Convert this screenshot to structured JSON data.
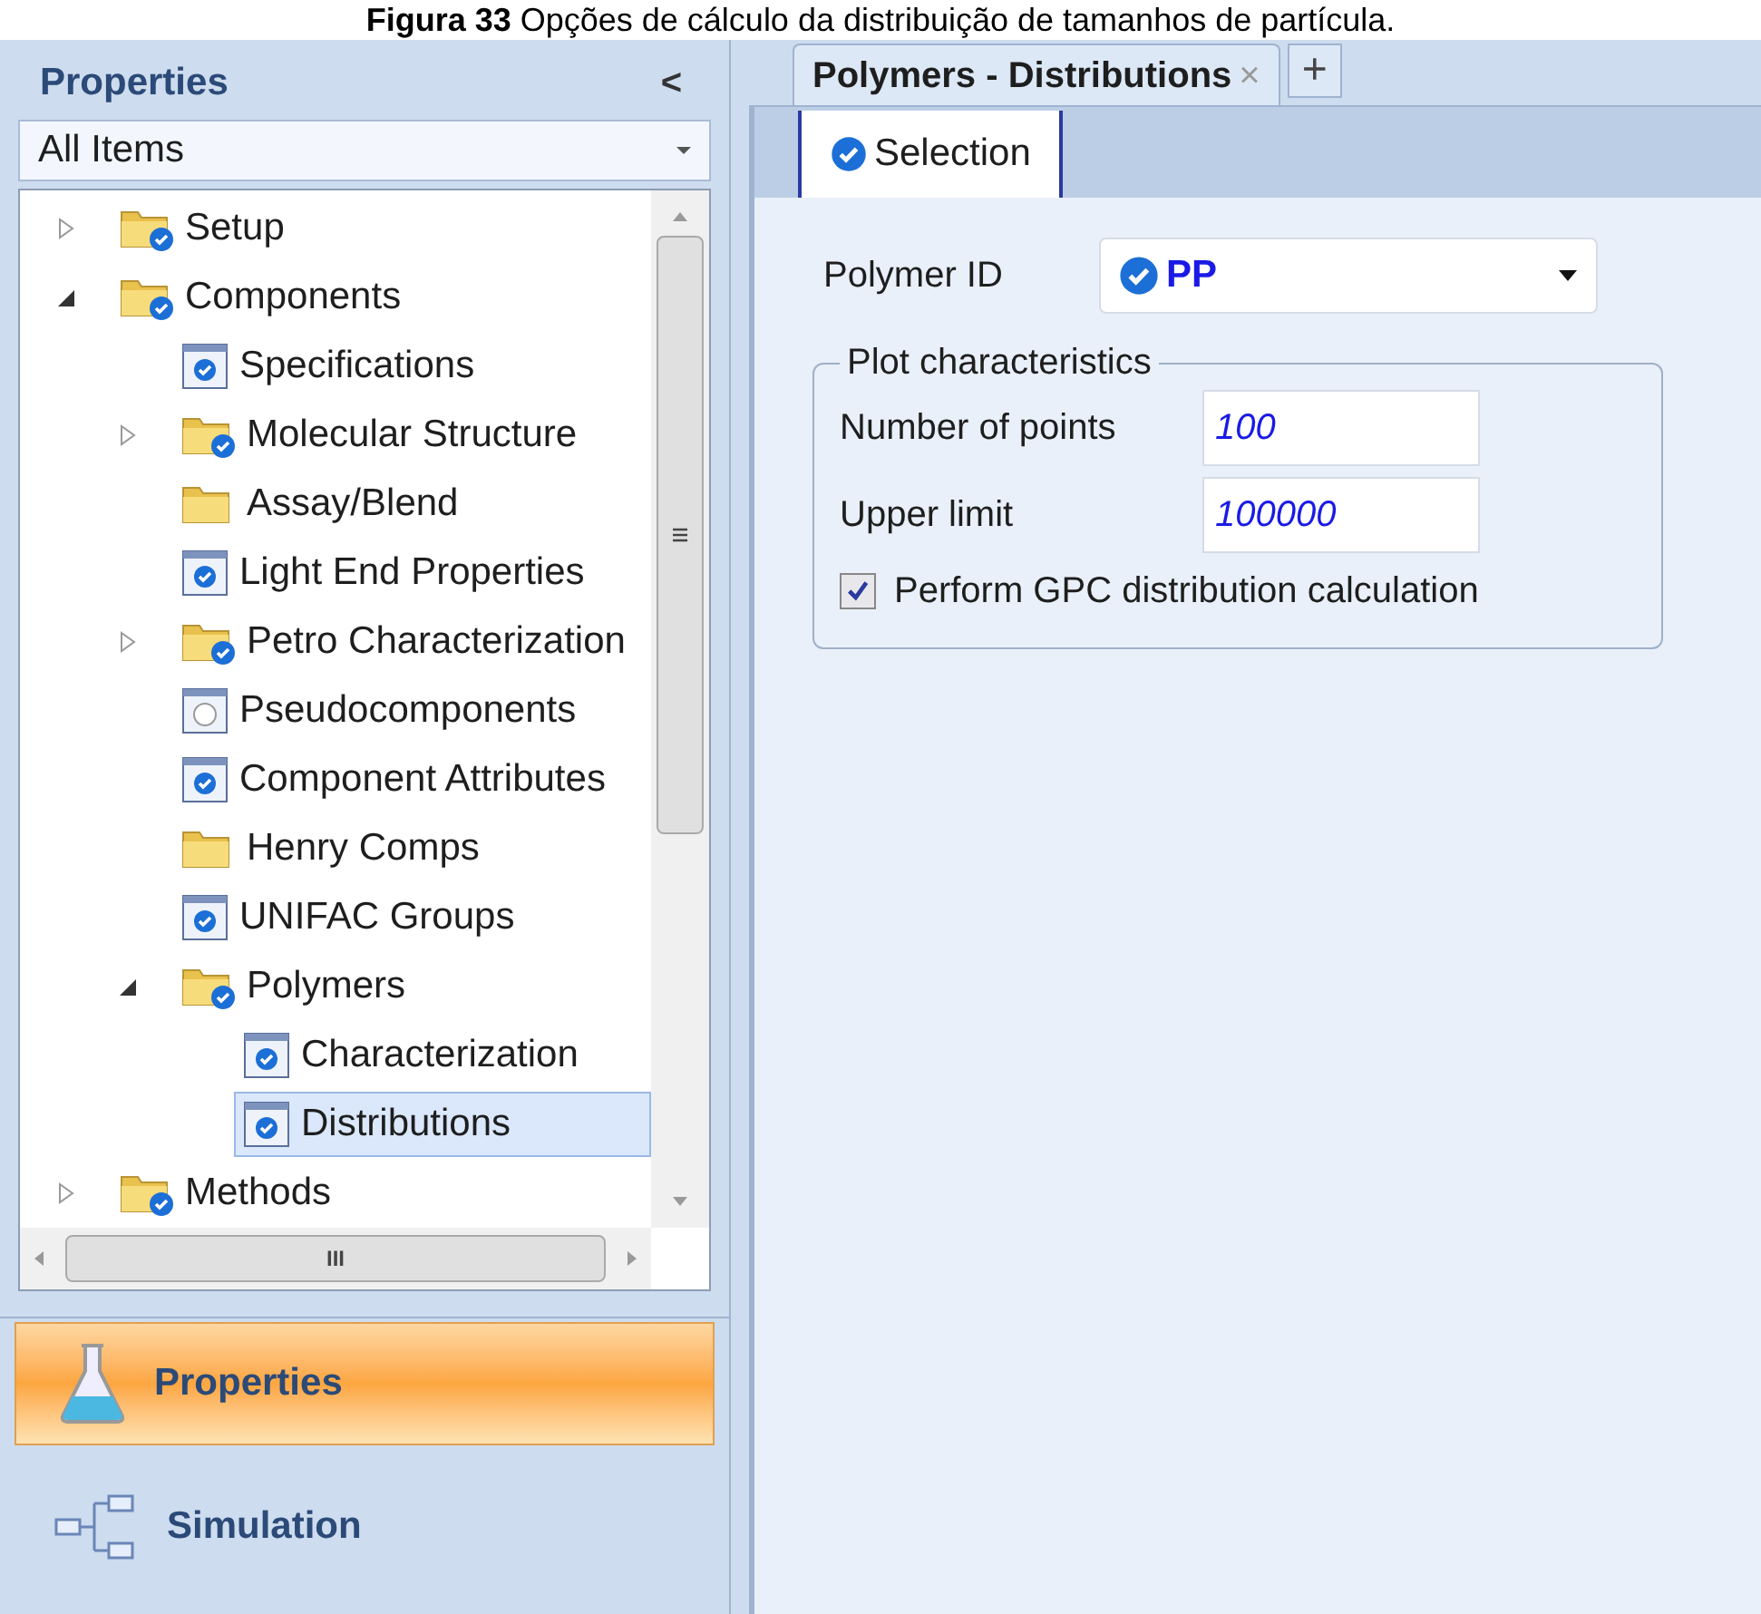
{
  "caption": "**Figura 33** Opções de cálculo da distribuição de tamanhos de partícula.",
  "sidebar": {
    "title": "Properties",
    "collapse_glyph": "<",
    "filter": {
      "value": "All Items"
    },
    "tree": [
      {
        "label": "Setup",
        "kind": "folder-check",
        "expanded": false,
        "selected": false
      },
      {
        "label": "Components",
        "kind": "folder-check",
        "expanded": true,
        "selected": false,
        "children": [
          {
            "label": "Specifications",
            "kind": "form-check",
            "selected": false
          },
          {
            "label": "Molecular Structure",
            "kind": "folder-check",
            "expanded": false,
            "selected": false
          },
          {
            "label": "Assay/Blend",
            "kind": "folder",
            "selected": false
          },
          {
            "label": "Light End Properties",
            "kind": "form-check",
            "selected": false
          },
          {
            "label": "Petro Characterization",
            "kind": "folder-check",
            "expanded": false,
            "selected": false
          },
          {
            "label": "Pseudocomponents",
            "kind": "form-empty",
            "selected": false
          },
          {
            "label": "Component Attributes",
            "kind": "form-check",
            "selected": false
          },
          {
            "label": "Henry Comps",
            "kind": "folder",
            "selected": false
          },
          {
            "label": "UNIFAC Groups",
            "kind": "form-check",
            "selected": false
          },
          {
            "label": "Polymers",
            "kind": "folder-check",
            "expanded": true,
            "selected": false,
            "children": [
              {
                "label": "Characterization",
                "kind": "form-check",
                "selected": false
              },
              {
                "label": "Distributions",
                "kind": "form-check",
                "selected": true
              }
            ]
          }
        ]
      },
      {
        "label": "Methods",
        "kind": "folder-check",
        "expanded": false,
        "selected": false
      }
    ],
    "scroll_grip": "III",
    "nav": [
      {
        "label": "Properties",
        "kind": "flask",
        "selected": true
      },
      {
        "label": "Simulation",
        "kind": "flowsheet",
        "selected": false
      }
    ]
  },
  "document_tabs": [
    {
      "label": "Polymers - Distributions",
      "selected": true,
      "close_glyph": "×"
    }
  ],
  "new_tab_glyph": "+",
  "form_tabs": [
    {
      "label": "Selection",
      "selected": true
    }
  ],
  "polymer_id": {
    "label": "Polymer ID",
    "value": "PP"
  },
  "plot_group": {
    "title": "Plot characteristics",
    "fields": [
      {
        "label": "Number of points",
        "value": "100"
      },
      {
        "label": "Upper limit",
        "value": "100000"
      }
    ],
    "gpc_checkbox": {
      "label": "Perform GPC distribution calculation",
      "checked": true
    }
  }
}
